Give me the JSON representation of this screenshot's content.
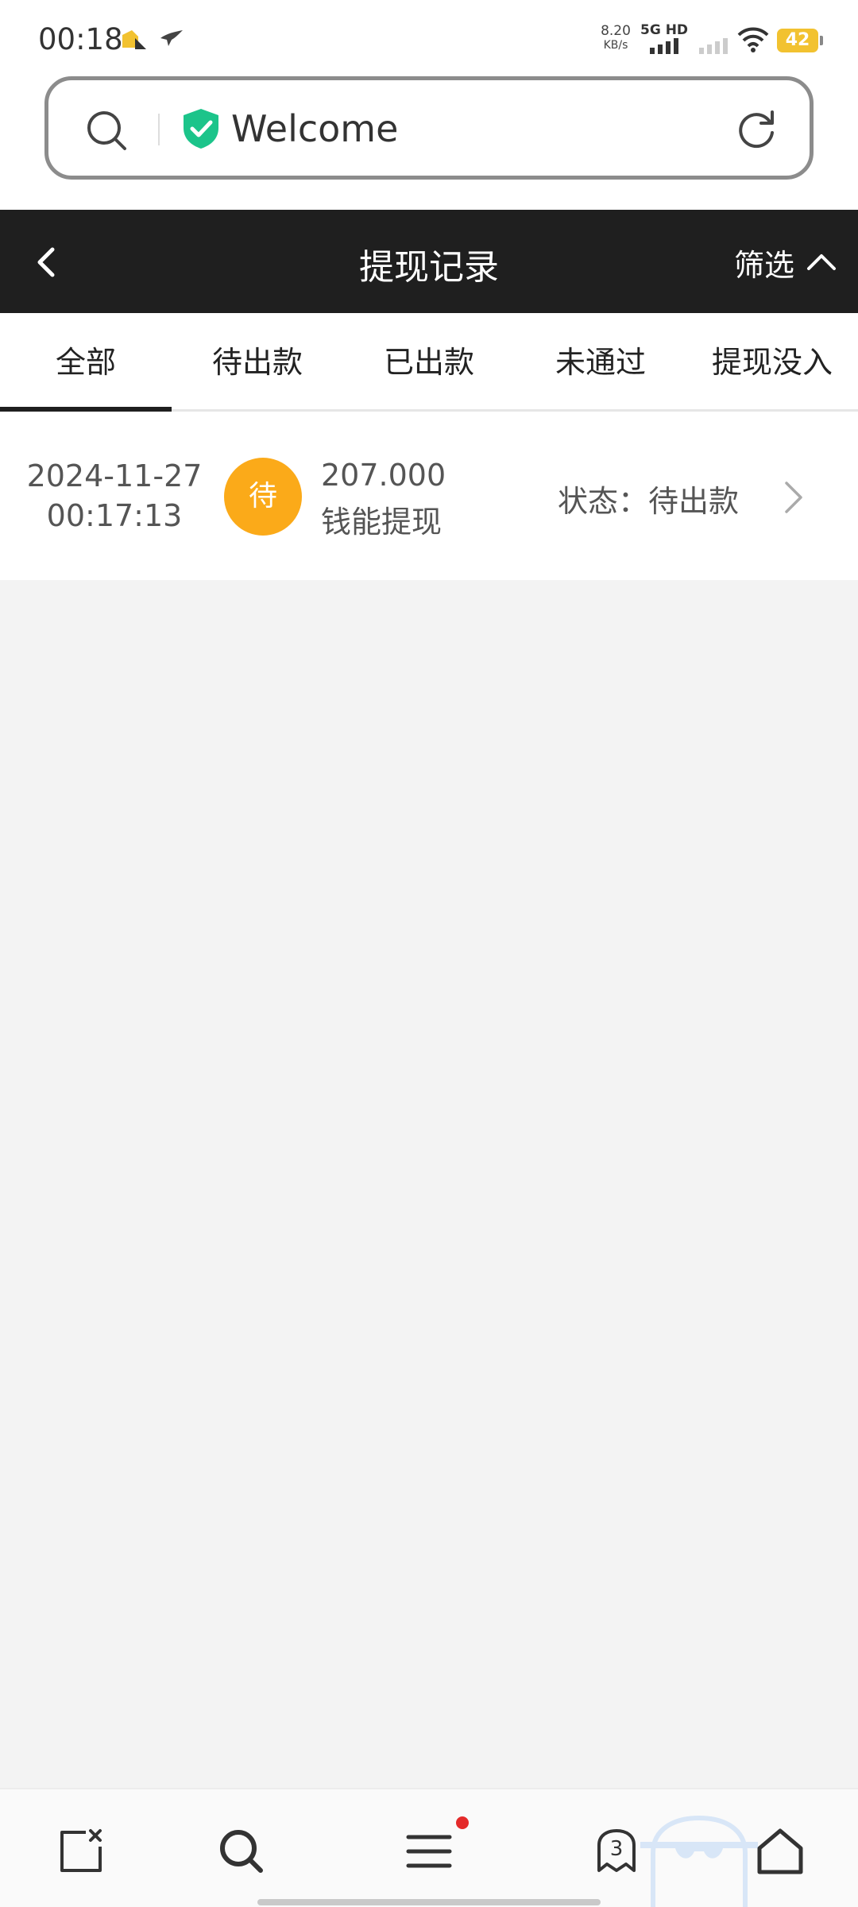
{
  "status_bar": {
    "time": "00:18",
    "net_speed_value": "8.20",
    "net_speed_unit": "KB/s",
    "network_label": "5G HD",
    "battery": "42"
  },
  "address_bar": {
    "text": "Welcome"
  },
  "header": {
    "title": "提现记录",
    "filter_label": "筛选"
  },
  "tabs": [
    {
      "label": "全部",
      "active": true
    },
    {
      "label": "待出款",
      "active": false
    },
    {
      "label": "已出款",
      "active": false
    },
    {
      "label": "未通过",
      "active": false
    },
    {
      "label": "提现没入",
      "active": false
    }
  ],
  "records": [
    {
      "date": "2024-11-27",
      "time": "00:17:13",
      "badge": "待",
      "amount": "207.000",
      "type": "钱能提现",
      "status": "状态：待出款"
    }
  ],
  "bottom_nav": {
    "tab_count": "3"
  },
  "colors": {
    "header_bg": "#1f1f1f",
    "badge_bg": "#fbaa19",
    "shield": "#1cc48a",
    "notification_dot": "#e42a2a"
  }
}
